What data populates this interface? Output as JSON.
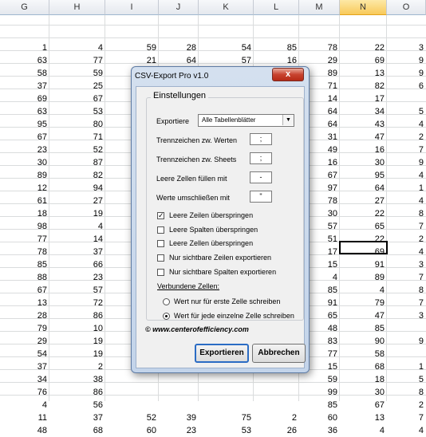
{
  "spreadsheet": {
    "columns": [
      "G",
      "H",
      "I",
      "J",
      "K",
      "L",
      "M",
      "N",
      "O"
    ],
    "selected_column": "N",
    "rows": [
      [
        "1",
        "4",
        "59",
        "28",
        "54",
        "85",
        "78",
        "22",
        "3"
      ],
      [
        "63",
        "77",
        "21",
        "64",
        "57",
        "16",
        "29",
        "69",
        "9"
      ],
      [
        "58",
        "59",
        "",
        "",
        "",
        "",
        "89",
        "13",
        "9"
      ],
      [
        "37",
        "25",
        "",
        "",
        "",
        "",
        "71",
        "82",
        "6"
      ],
      [
        "69",
        "67",
        "",
        "",
        "",
        "",
        "14",
        "17",
        ""
      ],
      [
        "63",
        "53",
        "",
        "",
        "",
        "",
        "64",
        "34",
        "5"
      ],
      [
        "95",
        "80",
        "",
        "",
        "",
        "",
        "64",
        "43",
        "4"
      ],
      [
        "67",
        "71",
        "",
        "",
        "",
        "",
        "31",
        "47",
        "2"
      ],
      [
        "23",
        "52",
        "",
        "",
        "",
        "",
        "49",
        "16",
        "7"
      ],
      [
        "30",
        "87",
        "",
        "",
        "",
        "",
        "16",
        "30",
        "9"
      ],
      [
        "89",
        "82",
        "",
        "",
        "",
        "",
        "67",
        "95",
        "4"
      ],
      [
        "12",
        "94",
        "",
        "",
        "",
        "",
        "97",
        "64",
        "1"
      ],
      [
        "61",
        "27",
        "",
        "",
        "",
        "",
        "78",
        "27",
        "4"
      ],
      [
        "18",
        "19",
        "",
        "",
        "",
        "",
        "30",
        "22",
        "8"
      ],
      [
        "98",
        "4",
        "",
        "",
        "",
        "",
        "57",
        "65",
        "7"
      ],
      [
        "77",
        "14",
        "",
        "",
        "",
        "",
        "51",
        "22",
        "2"
      ],
      [
        "78",
        "37",
        "",
        "",
        "",
        "",
        "17",
        "69",
        "4"
      ],
      [
        "85",
        "66",
        "",
        "",
        "",
        "",
        "15",
        "91",
        "3"
      ],
      [
        "88",
        "23",
        "",
        "",
        "",
        "",
        "4",
        "89",
        "7"
      ],
      [
        "67",
        "57",
        "",
        "",
        "",
        "",
        "85",
        "4",
        "8"
      ],
      [
        "13",
        "72",
        "",
        "",
        "",
        "",
        "91",
        "79",
        "7"
      ],
      [
        "28",
        "86",
        "",
        "",
        "",
        "",
        "65",
        "47",
        "3"
      ],
      [
        "79",
        "10",
        "",
        "",
        "",
        "",
        "48",
        "85",
        ""
      ],
      [
        "29",
        "19",
        "",
        "",
        "",
        "",
        "83",
        "90",
        "9"
      ],
      [
        "54",
        "19",
        "",
        "",
        "",
        "",
        "77",
        "58",
        ""
      ],
      [
        "37",
        "2",
        "",
        "",
        "",
        "",
        "15",
        "68",
        "1"
      ],
      [
        "34",
        "38",
        "",
        "",
        "",
        "",
        "59",
        "18",
        "5"
      ],
      [
        "76",
        "86",
        "",
        "",
        "",
        "",
        "99",
        "30",
        "8"
      ],
      [
        "4",
        "56",
        "",
        "",
        "",
        "",
        "85",
        "67",
        "2"
      ],
      [
        "11",
        "37",
        "52",
        "39",
        "75",
        "2",
        "60",
        "13",
        "7"
      ],
      [
        "48",
        "68",
        "60",
        "23",
        "53",
        "26",
        "36",
        "4",
        "4"
      ]
    ]
  },
  "dialog": {
    "title": "CSV-Export Pro v1.0",
    "close_label": "x",
    "group_label": "Einstellungen",
    "export_label": "Exportiere",
    "export_value": "Alle Tabellenblätter",
    "sep_values_label": "Trennzeichen zw. Werten",
    "sep_values": ";",
    "sep_sheets_label": "Trennzeichen  zw. Sheets",
    "sep_sheets": ";",
    "fill_empty_label": "Leere Zellen füllen mit",
    "fill_empty": "-",
    "enclose_label": "Werte umschließen mit",
    "enclose": "\"",
    "checkboxes": [
      {
        "label": "Leere Zeilen überspringen",
        "checked": true
      },
      {
        "label": "Leere Spalten überspringen",
        "checked": false
      },
      {
        "label": "Leere Zellen überspringen",
        "checked": false
      },
      {
        "label": "Nur sichtbare Zeilen exportieren",
        "checked": false
      },
      {
        "label": "Nur sichtbare Spalten exportieren",
        "checked": false
      }
    ],
    "merged_label": "Verbundene Zellen:",
    "radios": [
      {
        "label": "Wert nur für erste Zelle schreiben",
        "selected": false
      },
      {
        "label": "Wert für jede einzelne Zelle schreiben",
        "selected": true
      }
    ],
    "copyright": "© www.centerofefficiency.com",
    "export_button": "Exportieren",
    "cancel_button": "Abbrechen"
  }
}
